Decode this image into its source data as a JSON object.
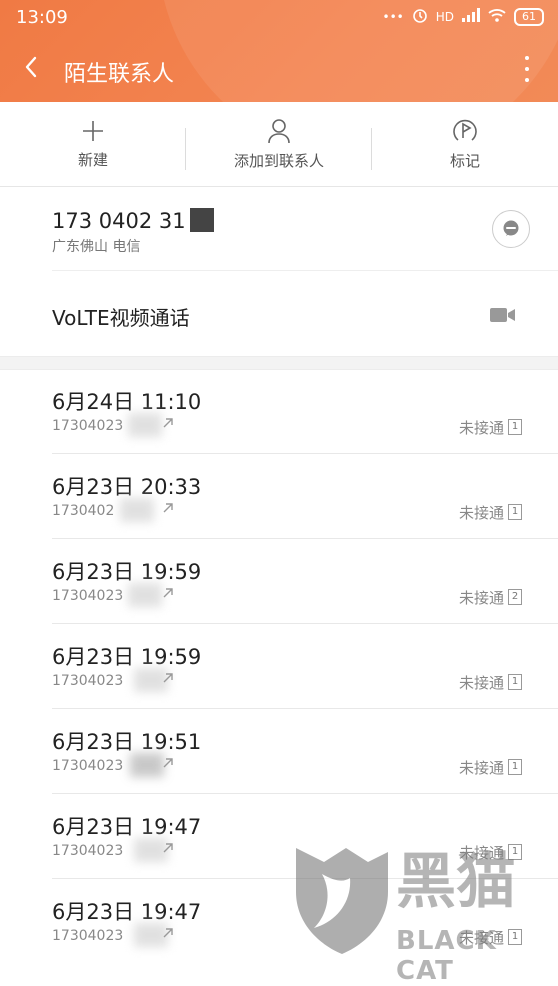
{
  "status_bar": {
    "time": "13:09",
    "signal_label": "HD",
    "battery": "61"
  },
  "header": {
    "title": "陌生联系人"
  },
  "toolbar": [
    {
      "label": "新建",
      "icon": "plus-icon"
    },
    {
      "label": "添加到联系人",
      "icon": "person-icon"
    },
    {
      "label": "标记",
      "icon": "flag-icon"
    }
  ],
  "contact": {
    "number": "173 0402 31",
    "location": "广东佛山 电信"
  },
  "volte": {
    "label": "VoLTE视频通话"
  },
  "calls": [
    {
      "date": "6月24日 11:10",
      "number": "17304023",
      "status": "未接通",
      "count": "1"
    },
    {
      "date": "6月23日 20:33",
      "number": "1730402",
      "status": "未接通",
      "count": "1"
    },
    {
      "date": "6月23日 19:59",
      "number": "17304023",
      "status": "未接通",
      "count": "2"
    },
    {
      "date": "6月23日 19:59",
      "number": "17304023",
      "status": "未接通",
      "count": "1"
    },
    {
      "date": "6月23日 19:51",
      "number": "17304023",
      "status": "未接通",
      "count": "1"
    },
    {
      "date": "6月23日 19:47",
      "number": "17304023",
      "status": "未接通",
      "count": "1"
    },
    {
      "date": "6月23日 19:47",
      "number": "17304023",
      "status": "未接通",
      "count": "1"
    }
  ],
  "watermark": {
    "cn": "黑猫",
    "en": "BLACK CAT"
  },
  "colors": {
    "accent": "#f07a44"
  }
}
